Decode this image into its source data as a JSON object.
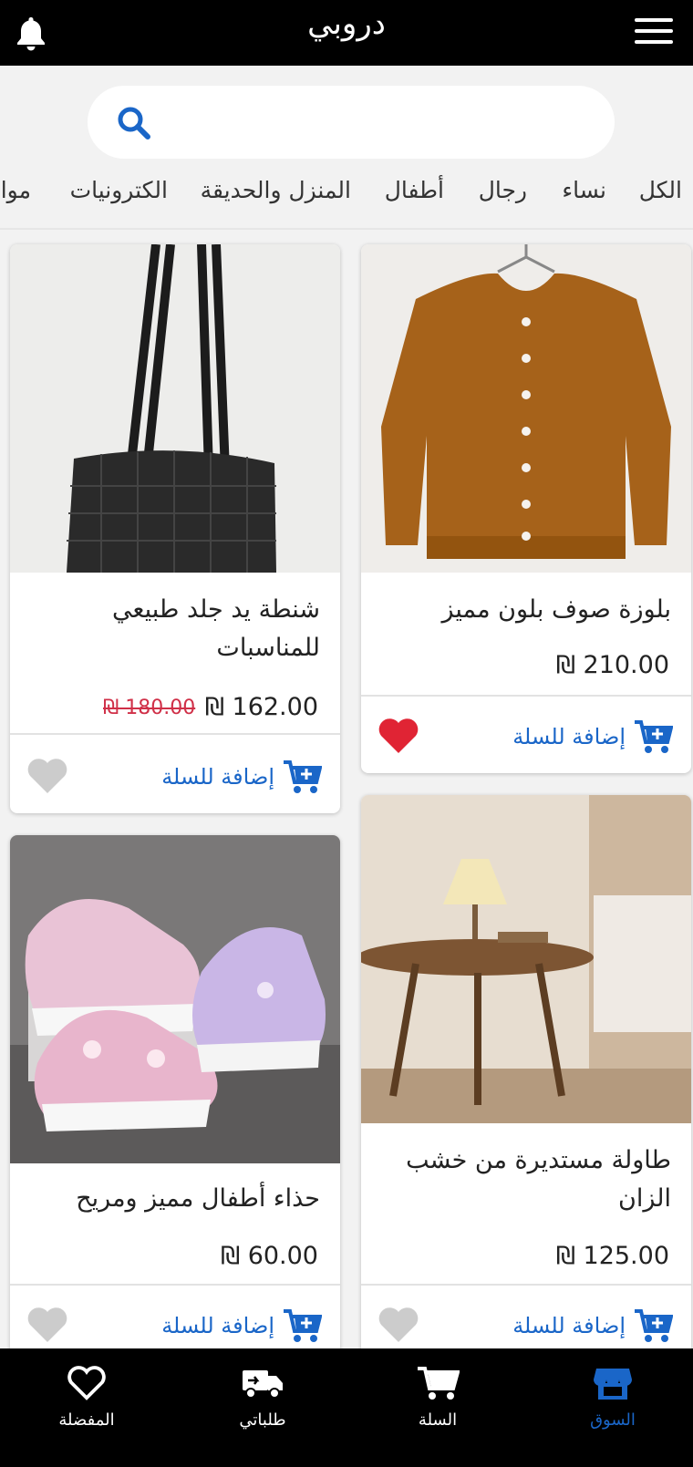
{
  "header": {
    "title": "دروبي",
    "bell_icon": "bell-icon",
    "menu_icon": "hamburger-menu-icon"
  },
  "search": {
    "placeholder": "",
    "icon": "search-icon"
  },
  "categories": [
    "الكل",
    "نساء",
    "رجال",
    "أطفال",
    "المنزل والحديقة",
    "الكترونيات",
    "موا"
  ],
  "products": [
    {
      "name": "بلوزة صوف بلون مميز",
      "price": "₪ 210.00",
      "add_to_cart": "إضافة للسلة",
      "favorite": true
    },
    {
      "name": "شنطة يد جلد طبيعي للمناسبات",
      "price": "₪ 162.00",
      "old_price": "₪ 180.00",
      "add_to_cart": "إضافة للسلة",
      "favorite": false
    },
    {
      "name": "طاولة مستديرة من خشب الزان",
      "price": "₪ 125.00",
      "add_to_cart": "إضافة للسلة",
      "favorite": false
    },
    {
      "name": "حذاء أطفال مميز ومريح",
      "price": "₪ 60.00",
      "add_to_cart": "إضافة للسلة",
      "favorite": false
    }
  ],
  "bottom_nav": [
    {
      "label": "السوق",
      "icon": "store-icon",
      "active": true
    },
    {
      "label": "السلة",
      "icon": "cart-icon",
      "active": false
    },
    {
      "label": "طلباتي",
      "icon": "delivery-truck-icon",
      "active": false
    },
    {
      "label": "المفضلة",
      "icon": "heart-icon",
      "active": false
    }
  ],
  "colors": {
    "accent": "#1a66c8",
    "header_bg": "#000000",
    "favorite_active": "#e02434",
    "favorite_inactive": "#cccccc",
    "old_price": "#d03048"
  }
}
